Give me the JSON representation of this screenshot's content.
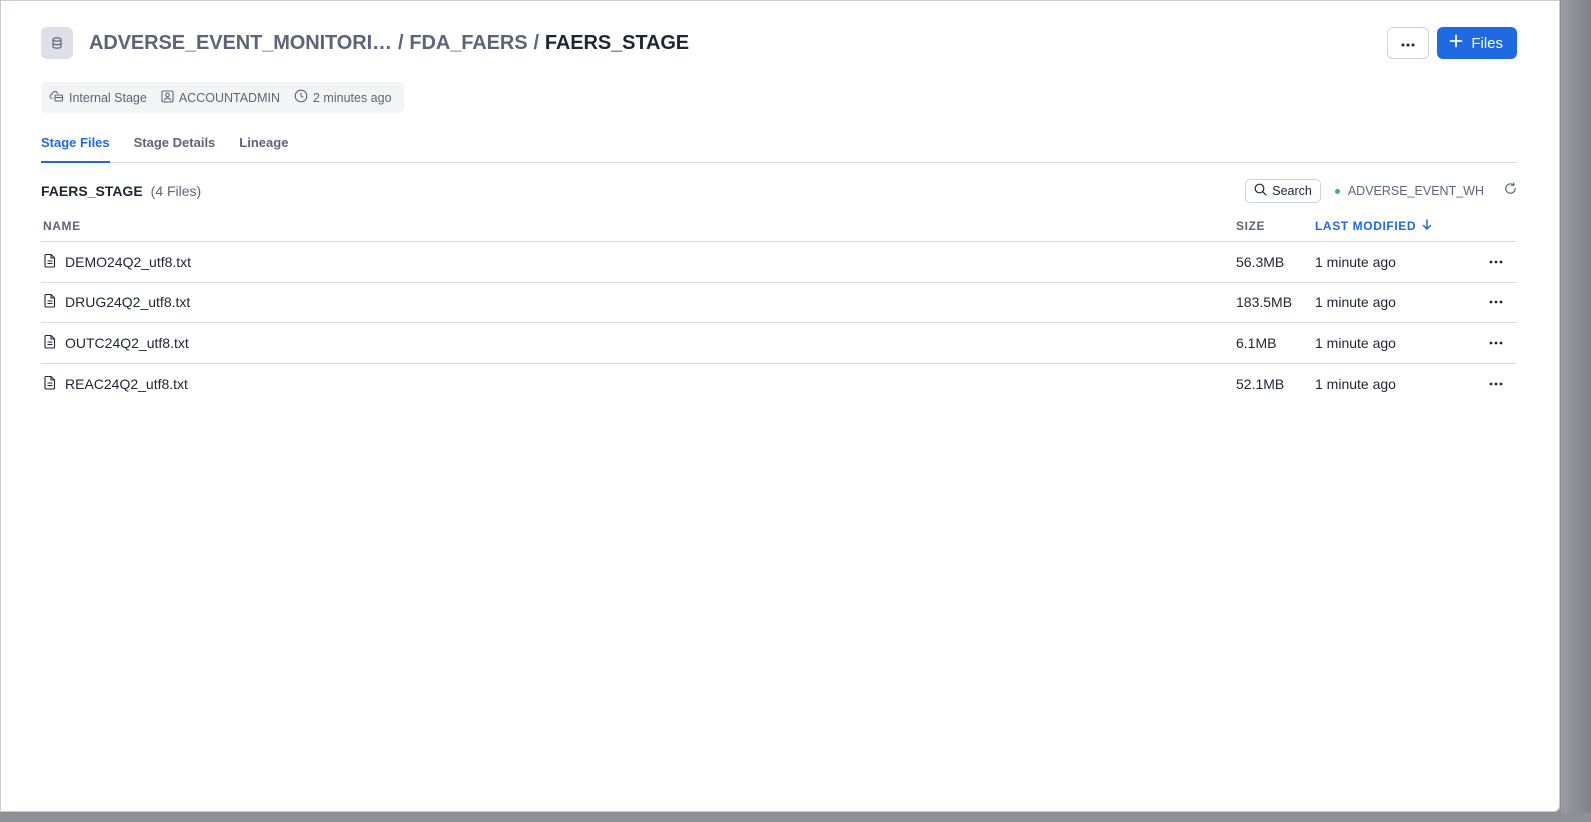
{
  "header": {
    "breadcrumb": [
      {
        "label": "ADVERSE_EVENT_MONITORI…"
      },
      {
        "label": "FDA_FAERS"
      }
    ],
    "separator": "/",
    "current": "FAERS_STAGE",
    "files_button": "Files"
  },
  "meta": {
    "stage_type": "Internal Stage",
    "owner": "ACCOUNTADMIN",
    "created": "2 minutes ago"
  },
  "tabs": [
    {
      "label": "Stage Files",
      "active": true
    },
    {
      "label": "Stage Details",
      "active": false
    },
    {
      "label": "Lineage",
      "active": false
    }
  ],
  "section": {
    "title": "FAERS_STAGE",
    "count": "(4 Files)",
    "search_label": "Search",
    "warehouse": "ADVERSE_EVENT_WH"
  },
  "table": {
    "columns": {
      "name": "NAME",
      "size": "SIZE",
      "modified": "LAST MODIFIED"
    },
    "rows": [
      {
        "name": "DEMO24Q2_utf8.txt",
        "size": "56.3MB",
        "modified": "1 minute ago"
      },
      {
        "name": "DRUG24Q2_utf8.txt",
        "size": "183.5MB",
        "modified": "1 minute ago"
      },
      {
        "name": "OUTC24Q2_utf8.txt",
        "size": "6.1MB",
        "modified": "1 minute ago"
      },
      {
        "name": "REAC24Q2_utf8.txt",
        "size": "52.1MB",
        "modified": "1 minute ago"
      }
    ]
  },
  "colors": {
    "accent": "#1f6ae0",
    "text_primary": "#1e2533",
    "text_secondary": "#5c6577",
    "warehouse_dot": "#2fb38a"
  },
  "icons": {
    "stage": "database-icon",
    "more": "more-horizontal-icon",
    "add": "plus-icon",
    "stage_type": "cloud-stage-icon",
    "owner": "user-badge-icon",
    "time": "clock-icon",
    "search": "search-icon",
    "refresh": "refresh-icon",
    "sort": "arrow-down-icon",
    "file": "file-text-icon"
  }
}
